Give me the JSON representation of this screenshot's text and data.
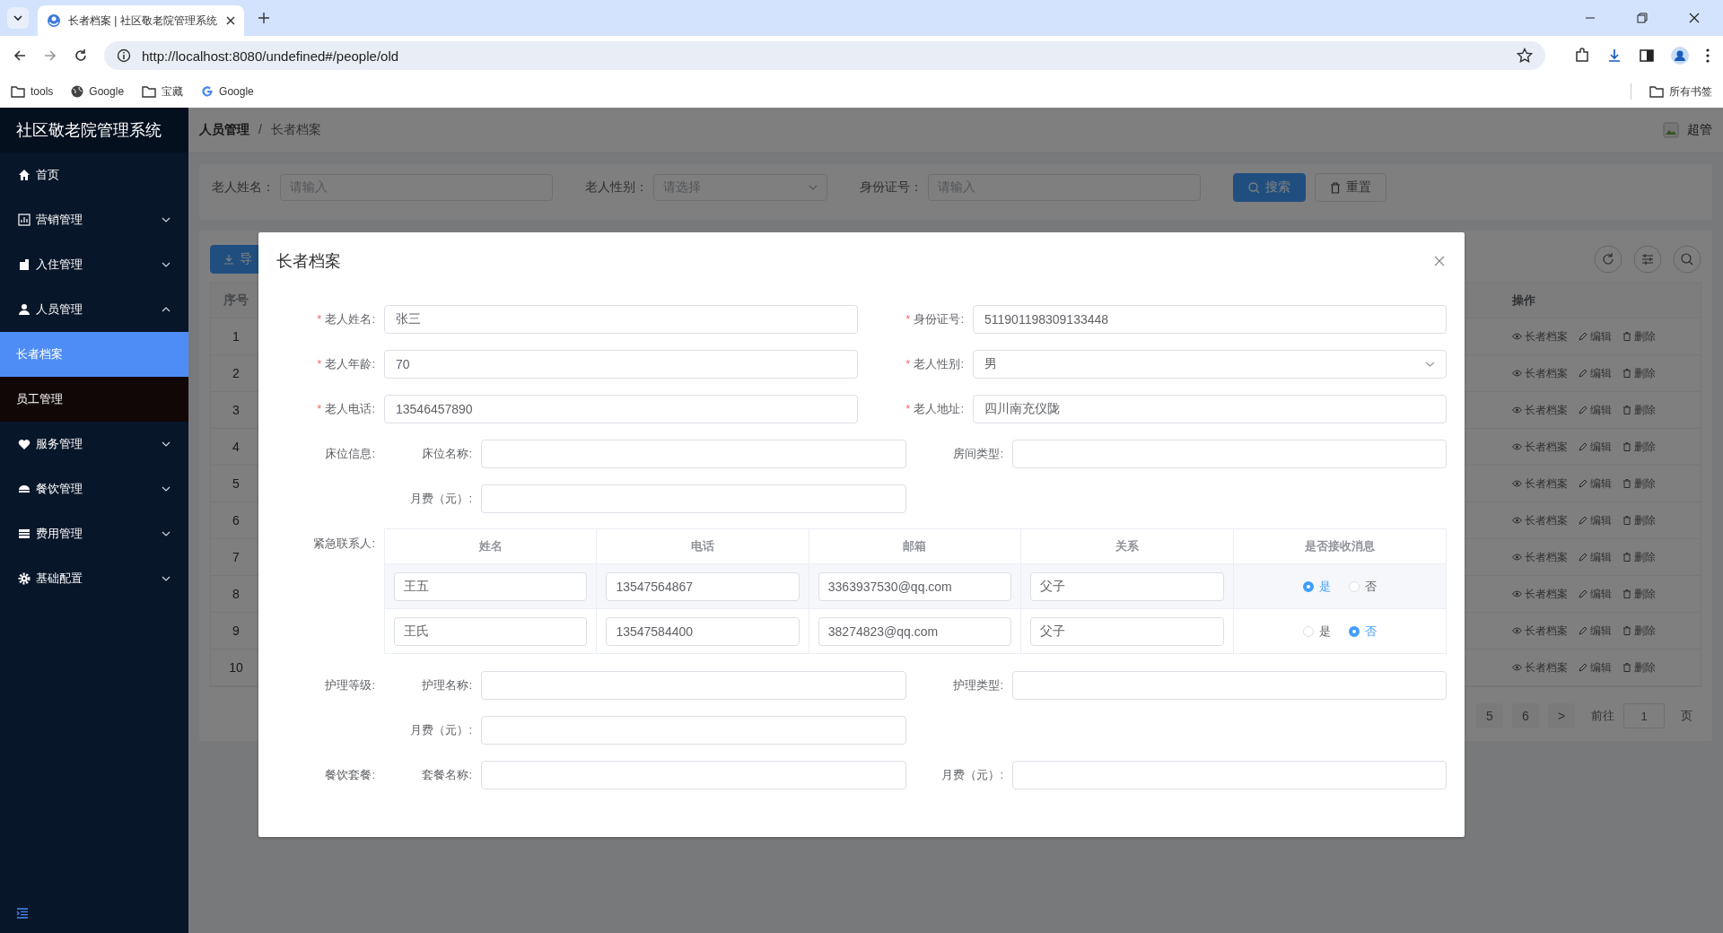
{
  "browser": {
    "tab_title": "长者档案 | 社区敬老院管理系统",
    "url": "http://localhost:8080/undefined#/people/old",
    "bookmarks": [
      {
        "label": "tools",
        "kind": "folder"
      },
      {
        "label": "Google",
        "kind": "globe"
      },
      {
        "label": "宝藏",
        "kind": "folder"
      },
      {
        "label": "Google",
        "kind": "google"
      }
    ],
    "all_bookmarks": "所有书签"
  },
  "sidebar": {
    "title": "社区敬老院管理系统",
    "items": [
      {
        "label": "首页",
        "expandable": false
      },
      {
        "label": "营销管理",
        "expandable": true,
        "expanded": false
      },
      {
        "label": "入住管理",
        "expandable": true,
        "expanded": false
      },
      {
        "label": "人员管理",
        "expandable": true,
        "expanded": true,
        "children": [
          {
            "label": "长者档案",
            "selected": true
          },
          {
            "label": "员工管理",
            "selected": false
          }
        ]
      },
      {
        "label": "服务管理",
        "expandable": true,
        "expanded": false
      },
      {
        "label": "餐饮管理",
        "expandable": true,
        "expanded": false
      },
      {
        "label": "费用管理",
        "expandable": true,
        "expanded": false
      },
      {
        "label": "基础配置",
        "expandable": true,
        "expanded": false
      }
    ]
  },
  "header": {
    "breadcrumb": [
      "人员管理",
      "长者档案"
    ],
    "separator": "/",
    "user": "超管"
  },
  "filters": [
    {
      "label": "老人姓名：",
      "placeholder": "请输入",
      "kind": "input"
    },
    {
      "label": "老人性别：",
      "placeholder": "请选择",
      "kind": "select"
    },
    {
      "label": "身份证号：",
      "placeholder": "请输入",
      "kind": "input"
    }
  ],
  "search_button": "搜索",
  "reset_button": "重置",
  "export_button": "导",
  "table": {
    "columns": [
      "序号",
      "操作"
    ],
    "rows": [
      {
        "index": "1",
        "actions": [
          "长者档案",
          "编辑",
          "删除"
        ]
      },
      {
        "index": "2",
        "actions": [
          "长者档案",
          "编辑",
          "删除"
        ]
      },
      {
        "index": "3",
        "actions": [
          "长者档案",
          "编辑",
          "删除"
        ]
      },
      {
        "index": "4",
        "actions": [
          "长者档案",
          "编辑",
          "删除"
        ]
      },
      {
        "index": "5",
        "actions": [
          "长者档案",
          "编辑",
          "删除"
        ]
      },
      {
        "index": "6",
        "actions": [
          "长者档案",
          "编辑",
          "删除"
        ]
      },
      {
        "index": "7",
        "actions": [
          "长者档案",
          "编辑",
          "删除"
        ]
      },
      {
        "index": "8",
        "actions": [
          "长者档案",
          "编辑",
          "删除"
        ]
      },
      {
        "index": "9",
        "actions": [
          "长者档案",
          "编辑",
          "删除"
        ]
      },
      {
        "index": "10",
        "actions": [
          "长者档案",
          "编辑",
          "删除"
        ]
      }
    ]
  },
  "pagination": {
    "pages": [
      {
        "label": "5",
        "selected": false
      },
      {
        "label": "6",
        "selected": false
      }
    ],
    "next": ">",
    "goto_label": "前往",
    "goto_value": "1",
    "goto_suffix": "页"
  },
  "dialog": {
    "title": "长者档案",
    "required_mark": "*",
    "fields": [
      {
        "label": "老人姓名:",
        "value": "张三",
        "required": true,
        "kind": "input"
      },
      {
        "label": "身份证号:",
        "value": "511901198309133448",
        "required": true,
        "kind": "input"
      },
      {
        "label": "老人年龄:",
        "value": "70",
        "required": true,
        "kind": "input"
      },
      {
        "label": "老人性别:",
        "value": "男",
        "required": true,
        "kind": "select"
      },
      {
        "label": "老人电话:",
        "value": "13546457890",
        "required": true,
        "kind": "input"
      },
      {
        "label": "老人地址:",
        "value": "四川南充仪陇",
        "required": true,
        "kind": "input"
      }
    ],
    "bed": {
      "label": "床位信息:",
      "fields": [
        {
          "label": "床位名称:"
        },
        {
          "label": "房间类型:"
        },
        {
          "label": "月费（元）:"
        }
      ]
    },
    "contacts": {
      "label": "紧急联系人:",
      "columns": [
        "姓名",
        "电话",
        "邮箱",
        "关系",
        "是否接收消息"
      ],
      "rows": [
        {
          "name": "王五",
          "phone": "13547564867",
          "email": "3363937530@qq.com",
          "relation": "父子",
          "options": [
            {
              "label": "是",
              "selected": true
            },
            {
              "label": "否",
              "selected": false
            }
          ]
        },
        {
          "name": "王氏",
          "phone": "13547584400",
          "email": "38274823@qq.com",
          "relation": "父子",
          "options": [
            {
              "label": "是",
              "selected": false
            },
            {
              "label": "否",
              "selected": true
            }
          ]
        }
      ]
    },
    "nursing": {
      "label": "护理等级:",
      "fields": [
        {
          "label": "护理名称:"
        },
        {
          "label": "护理类型:"
        },
        {
          "label": "月费（元）:"
        }
      ]
    },
    "meal": {
      "label": "餐饮套餐:",
      "fields": [
        {
          "label": "套餐名称:"
        },
        {
          "label": "月费（元）:"
        }
      ]
    }
  }
}
